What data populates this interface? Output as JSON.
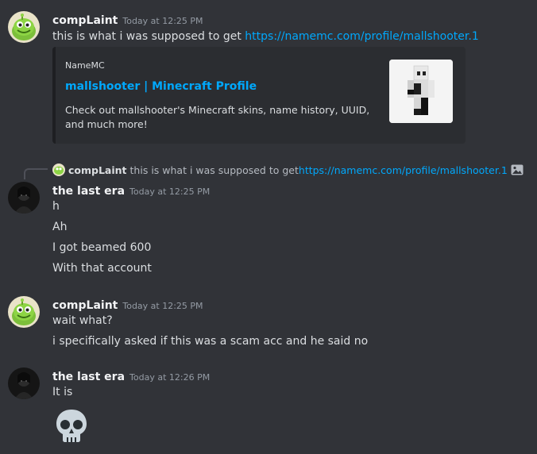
{
  "messages": [
    {
      "author": "compLaint",
      "timestamp": "Today at 12:25 PM",
      "avatar_icon": "om-nom-green-monster",
      "lines": [
        {
          "text": "this is what i was supposed to get ",
          "link": "https://namemc.com/profile/mallshooter.1"
        }
      ],
      "embed": {
        "provider": "NameMC",
        "title": "mallshooter | Minecraft Profile",
        "description": "Check out mallshooter's Minecraft skins, name history, UUID, and much more!",
        "thumbnail_icon": "minecraft-skin-preview"
      }
    },
    {
      "reply_to": {
        "author": "compLaint",
        "text": "this is what i was supposed to get ",
        "link": "https://namemc.com/profile/mallshooter.1",
        "attachment_icon": "image-icon"
      },
      "author": "the last era",
      "timestamp": "Today at 12:25 PM",
      "avatar_icon": "dark-figure-avatar",
      "lines": [
        "h",
        "Ah",
        "I got beamed 600",
        "With that account"
      ]
    },
    {
      "author": "compLaint",
      "timestamp": "Today at 12:25 PM",
      "avatar_icon": "om-nom-green-monster",
      "lines": [
        "wait what?",
        "i specifically asked if this was a scam acc and he said no"
      ]
    },
    {
      "author": "the last era",
      "timestamp": "Today at 12:26 PM",
      "avatar_icon": "dark-figure-avatar",
      "lines": [
        "It is"
      ],
      "emoji": "skull-emoji"
    }
  ],
  "colors": {
    "background": "#313338",
    "link": "#00a8fc",
    "embed_bg": "#2b2d31",
    "username": "#f2f3f5",
    "timestamp": "#949ba4"
  }
}
